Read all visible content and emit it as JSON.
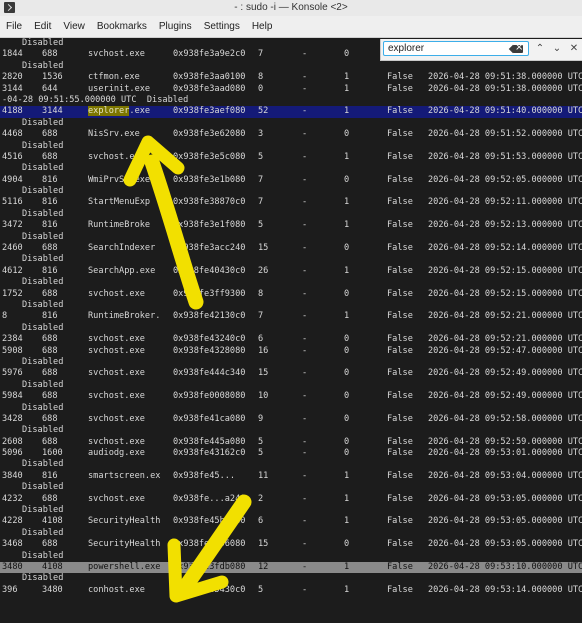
{
  "window": {
    "title": "- : sudo -i — Konsole <2>"
  },
  "menu": [
    "File",
    "Edit",
    "View",
    "Bookmarks",
    "Plugins",
    "Settings",
    "Help"
  ],
  "search": {
    "value": "explorer",
    "prev_glyph": "⌃",
    "next_glyph": "⌄",
    "close_glyph": "✕"
  },
  "annotation_color": "#f2e000",
  "lines": [
    {
      "type": "dis",
      "text": "Disabled"
    },
    {
      "type": "row",
      "pid": "1844",
      "ppid": "688",
      "name": "svchost.exe",
      "addr": "0x938fe3a9e2c0",
      "thr": "7",
      "hnd": "-",
      "sess": "0",
      "wow": "",
      "time": ""
    },
    {
      "type": "dis",
      "text": "Disabled"
    },
    {
      "type": "row",
      "pid": "2820",
      "ppid": "1536",
      "name": "ctfmon.exe",
      "addr": "0x938fe3aa0100",
      "thr": "8",
      "hnd": "-",
      "sess": "1",
      "wow": "False",
      "time": "2026-04-28 09:51:38.000000 UTC"
    },
    {
      "type": "row",
      "pid": "3144",
      "ppid": "644",
      "name": "userinit.exe",
      "addr": "0x938fe3aad080",
      "thr": "0",
      "hnd": "-",
      "sess": "1",
      "wow": "False",
      "time": "2026-04-28 09:51:38.000000 UTC"
    },
    {
      "type": "cont",
      "text": "-04-28 09:51:55.000000 UTC  Disabled"
    },
    {
      "type": "row",
      "hl": "blue",
      "pid": "4188",
      "ppid": "3144",
      "name_match": "explorer",
      "name_rest": ".exe",
      "addr": "0x938fe3aef080",
      "thr": "52",
      "hnd": "-",
      "sess": "1",
      "wow": "False",
      "time": "2026-04-28 09:51:40.000000 UTC"
    },
    {
      "type": "dis",
      "text": "Disabled"
    },
    {
      "type": "row",
      "pid": "4468",
      "ppid": "688",
      "name": "NisSrv.exe",
      "addr": "0x938fe3e62080",
      "thr": "3",
      "hnd": "-",
      "sess": "0",
      "wow": "False",
      "time": "2026-04-28 09:51:52.000000 UTC"
    },
    {
      "type": "dis",
      "text": "Disabled"
    },
    {
      "type": "row",
      "pid": "4516",
      "ppid": "688",
      "name": "svchost.exe",
      "addr": "0x938fe3e5c080",
      "thr": "5",
      "hnd": "-",
      "sess": "1",
      "wow": "False",
      "time": "2026-04-28 09:51:53.000000 UTC"
    },
    {
      "type": "dis",
      "text": "Disabled"
    },
    {
      "type": "row",
      "pid": "4904",
      "ppid": "816",
      "name": "WmiPrvSE.exe",
      "addr": "0x938fe3e1b080",
      "thr": "7",
      "hnd": "-",
      "sess": "0",
      "wow": "False",
      "time": "2026-04-28 09:52:05.000000 UTC"
    },
    {
      "type": "dis",
      "text": "Disabled"
    },
    {
      "type": "row",
      "pid": "5116",
      "ppid": "816",
      "name": "StartMenuExp",
      "addr": "0x938fe38870c0",
      "thr": "7",
      "hnd": "-",
      "sess": "1",
      "wow": "False",
      "time": "2026-04-28 09:52:11.000000 UTC"
    },
    {
      "type": "dis",
      "text": "Disabled"
    },
    {
      "type": "row",
      "pid": "3472",
      "ppid": "816",
      "name": "RuntimeBroke",
      "addr": "0x938fe3e1f080",
      "thr": "5",
      "hnd": "-",
      "sess": "1",
      "wow": "False",
      "time": "2026-04-28 09:52:13.000000 UTC"
    },
    {
      "type": "dis",
      "text": "Disabled"
    },
    {
      "type": "row",
      "pid": "2460",
      "ppid": "688",
      "name": "SearchIndexer",
      "addr": "0x938fe3acc240",
      "thr": "15",
      "hnd": "-",
      "sess": "0",
      "wow": "False",
      "time": "2026-04-28 09:52:14.000000 UTC"
    },
    {
      "type": "dis",
      "text": "Disabled"
    },
    {
      "type": "row",
      "pid": "4612",
      "ppid": "816",
      "name": "SearchApp.exe",
      "addr": "0x938fe40430c0",
      "thr": "26",
      "hnd": "-",
      "sess": "1",
      "wow": "False",
      "time": "2026-04-28 09:52:15.000000 UTC"
    },
    {
      "type": "dis",
      "text": "Disabled"
    },
    {
      "type": "row",
      "pid": "1752",
      "ppid": "688",
      "name": "svchost.exe",
      "addr": "0x938fe3ff9300",
      "thr": "8",
      "hnd": "-",
      "sess": "0",
      "wow": "False",
      "time": "2026-04-28 09:52:15.000000 UTC"
    },
    {
      "type": "dis",
      "text": "Disabled"
    },
    {
      "type": "row",
      "pid": "8",
      "ppid": "816",
      "name": "RuntimeBroker.",
      "addr": "0x938fe42130c0",
      "thr": "7",
      "hnd": "-",
      "sess": "1",
      "wow": "False",
      "time": "2026-04-28 09:52:21.000000 UTC"
    },
    {
      "type": "dis",
      "text": "Disabled"
    },
    {
      "type": "row",
      "pid": "2384",
      "ppid": "688",
      "name": "svchost.exe",
      "addr": "0x938fe43240c0",
      "thr": "6",
      "hnd": "-",
      "sess": "0",
      "wow": "False",
      "time": "2026-04-28 09:52:21.000000 UTC"
    },
    {
      "type": "row",
      "pid": "5908",
      "ppid": "688",
      "name": "svchost.exe",
      "addr": "0x938fe4328080",
      "thr": "16",
      "hnd": "-",
      "sess": "0",
      "wow": "False",
      "time": "2026-04-28 09:52:47.000000 UTC"
    },
    {
      "type": "dis",
      "text": "Disabled"
    },
    {
      "type": "row",
      "pid": "5976",
      "ppid": "688",
      "name": "svchost.exe",
      "addr": "0x938fe444c340",
      "thr": "15",
      "hnd": "-",
      "sess": "0",
      "wow": "False",
      "time": "2026-04-28 09:52:49.000000 UTC"
    },
    {
      "type": "dis",
      "text": "Disabled"
    },
    {
      "type": "row",
      "pid": "5984",
      "ppid": "688",
      "name": "svchost.exe",
      "addr": "0x938fe0008080",
      "thr": "10",
      "hnd": "-",
      "sess": "0",
      "wow": "False",
      "time": "2026-04-28 09:52:49.000000 UTC"
    },
    {
      "type": "dis",
      "text": "Disabled"
    },
    {
      "type": "row",
      "pid": "3428",
      "ppid": "688",
      "name": "svchost.exe",
      "addr": "0x938fe41ca080",
      "thr": "9",
      "hnd": "-",
      "sess": "0",
      "wow": "False",
      "time": "2026-04-28 09:52:58.000000 UTC"
    },
    {
      "type": "dis",
      "text": "Disabled"
    },
    {
      "type": "row",
      "pid": "2608",
      "ppid": "688",
      "name": "svchost.exe",
      "addr": "0x938fe445a080",
      "thr": "5",
      "hnd": "-",
      "sess": "0",
      "wow": "False",
      "time": "2026-04-28 09:52:59.000000 UTC"
    },
    {
      "type": "row",
      "pid": "5096",
      "ppid": "1600",
      "name": "audiodg.exe",
      "addr": "0x938fe43162c0",
      "thr": "5",
      "hnd": "-",
      "sess": "0",
      "wow": "False",
      "time": "2026-04-28 09:53:01.000000 UTC"
    },
    {
      "type": "dis",
      "text": "Disabled"
    },
    {
      "type": "row",
      "pid": "3840",
      "ppid": "816",
      "name": "smartscreen.ex",
      "addr": "0x938fe45...",
      "thr": "11",
      "hnd": "-",
      "sess": "1",
      "wow": "False",
      "time": "2026-04-28 09:53:04.000000 UTC"
    },
    {
      "type": "dis",
      "text": "Disabled"
    },
    {
      "type": "row",
      "pid": "4232",
      "ppid": "688",
      "name": "svchost.exe",
      "addr": "0x938fe...a240",
      "thr": "2",
      "hnd": "-",
      "sess": "1",
      "wow": "False",
      "time": "2026-04-28 09:53:05.000000 UTC"
    },
    {
      "type": "dis",
      "text": "Disabled"
    },
    {
      "type": "row",
      "pid": "4228",
      "ppid": "4108",
      "name": "SecurityHealth",
      "addr": "0x938fe45bf080",
      "thr": "6",
      "hnd": "-",
      "sess": "1",
      "wow": "False",
      "time": "2026-04-28 09:53:05.000000 UTC"
    },
    {
      "type": "dis",
      "text": "Disabled"
    },
    {
      "type": "row",
      "pid": "3468",
      "ppid": "688",
      "name": "SecurityHealth",
      "addr": "0x938fe3a56080",
      "thr": "15",
      "hnd": "-",
      "sess": "0",
      "wow": "False",
      "time": "2026-04-28 09:53:05.000000 UTC"
    },
    {
      "type": "dis",
      "text": "Disabled"
    },
    {
      "type": "row",
      "hl": "gray",
      "pid": "3480",
      "ppid": "4108",
      "name": "powershell.exe",
      "addr": "0x938fe3fdb080",
      "thr": "12",
      "hnd": "-",
      "sess": "1",
      "wow": "False",
      "time": "2026-04-28 09:53:10.000000 UTC"
    },
    {
      "type": "dis",
      "text": "Disabled"
    },
    {
      "type": "row",
      "pid": "396",
      "ppid": "3480",
      "name": "conhost.exe",
      "addr": "0x938fe45430c0",
      "thr": "5",
      "hnd": "-",
      "sess": "1",
      "wow": "False",
      "time": "2026-04-28 09:53:14.000000 UTC"
    }
  ]
}
